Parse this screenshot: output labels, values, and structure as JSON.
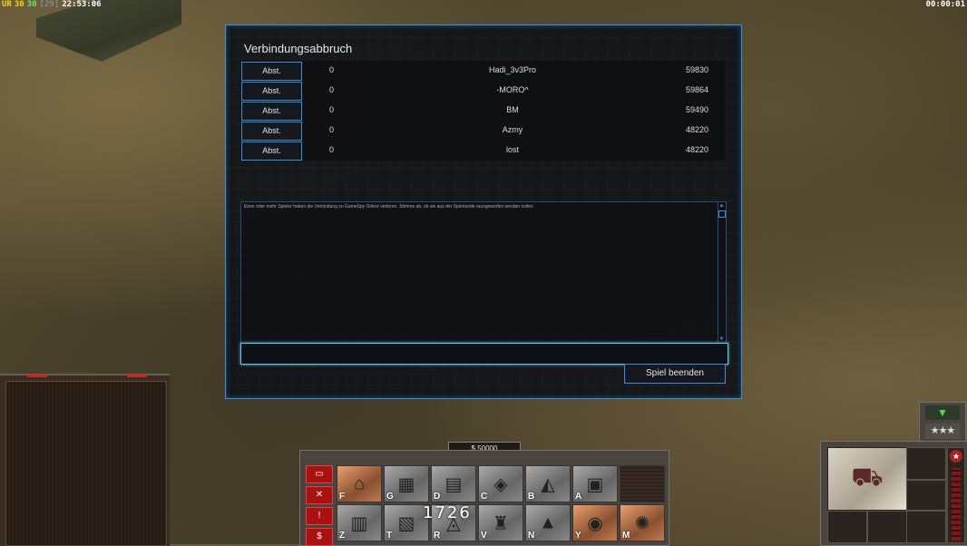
{
  "hud": {
    "faction": "UR",
    "stat1": "30",
    "stat2": "30",
    "stat3": "[29]",
    "clock": "22:53:06",
    "timer": "00:00:01"
  },
  "dialog": {
    "title": "Verbindungsabbruch",
    "kick_label": "Abst.",
    "players": [
      {
        "votes": "0",
        "name": "Hadi_3v3Pro",
        "ping": "59830"
      },
      {
        "votes": "0",
        "name": "-MORO^",
        "ping": "59864"
      },
      {
        "votes": "0",
        "name": "BM",
        "ping": "59490"
      },
      {
        "votes": "0",
        "name": "Azmy",
        "ping": "48220"
      },
      {
        "votes": "0",
        "name": "lost",
        "ping": "48220"
      }
    ],
    "message": "Einer oder mehr Spieler haben die Verbindung zu GameSpy Online verloren. Stimme ab, ob sie aus der Spielrunde rausgeworfen werden sollen.",
    "chat_value": "",
    "quit_label": "Spiel beenden"
  },
  "command_bar": {
    "money": "$ 50000",
    "overlay_text": "1726",
    "hotkeys_top": [
      "F",
      "G",
      "D",
      "C",
      "B",
      "A",
      ""
    ],
    "hotkeys_bottom": [
      "Z",
      "T",
      "R",
      "V",
      "N",
      "Y",
      "M"
    ]
  },
  "colors": {
    "accent": "#3c8fd8",
    "chat_border": "#5fc6e8",
    "hud_yellow": "#f0d020",
    "hud_green": "#6fe36f"
  }
}
